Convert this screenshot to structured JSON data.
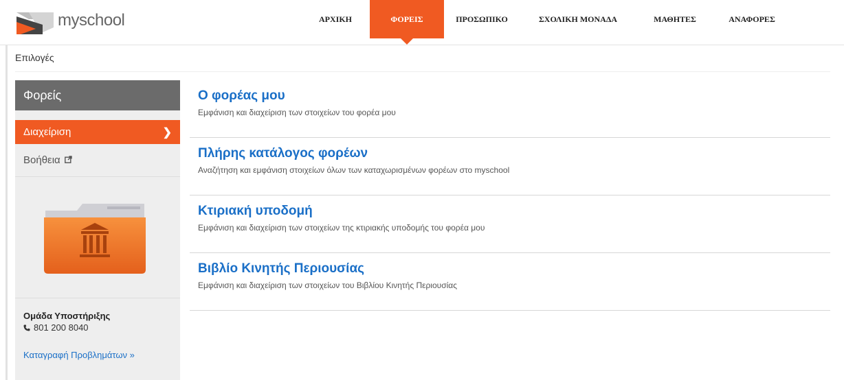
{
  "brand": {
    "name": "myschool",
    "accent": "#f05a22",
    "link_color": "#1a6fc7"
  },
  "nav": {
    "items": [
      {
        "label": "ΑΡΧΙΚΗ",
        "active": false
      },
      {
        "label": "ΦΟΡΕΙΣ",
        "active": true
      },
      {
        "label": "ΠΡΟΣΩΠΙΚΟ",
        "active": false
      },
      {
        "label": "ΣΧΟΛΙΚΗ ΜΟΝΑΔΑ",
        "active": false
      },
      {
        "label": "ΜΑΘΗΤΕΣ",
        "active": false
      },
      {
        "label": "ΑΝΑΦΟΡΕΣ",
        "active": false
      }
    ]
  },
  "breadcrumb": "Επιλογές",
  "sidebar": {
    "header": "Φορείς",
    "active_item": "Διαχείριση",
    "help_label": "Βοήθεια",
    "folder_icon": "folder-building-icon",
    "support_title": "Ομάδα Υποστήριξης",
    "support_phone": "801 200 8040",
    "report_link": "Καταγραφή Προβλημάτων »"
  },
  "content": {
    "items": [
      {
        "title": "Ο φορέας μου",
        "desc": "Εμφάνιση και διαχείριση των στοιχείων του φορέα μου"
      },
      {
        "title": "Πλήρης κατάλογος φορέων",
        "desc": "Αναζήτηση και εμφάνιση στοιχείων όλων των καταχωρισμένων φορέων στο myschool"
      },
      {
        "title": "Κτιριακή υποδομή",
        "desc": "Εμφάνιση και διαχείριση των στοιχείων της κτιριακής υποδομής του φορέα μου"
      },
      {
        "title": "Βιβλίο Κινητής Περιουσίας",
        "desc": "Εμφάνιση και διαχείριση των στοιχείων του Βιβλίου Κινητής Περιουσίας"
      }
    ]
  }
}
